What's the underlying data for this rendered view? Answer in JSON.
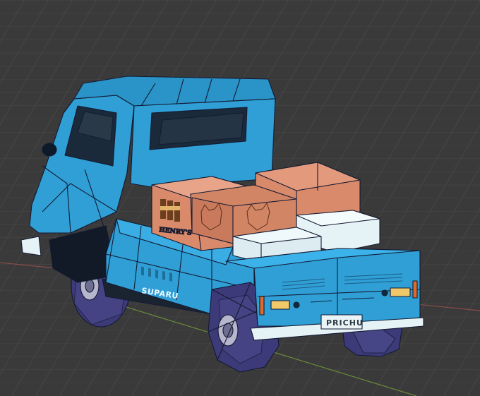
{
  "scene": {
    "background_color": "#3a3a3a",
    "grid_color": "#4a4a4a",
    "axis_red_color": "#8a4a4a",
    "axis_green_color": "#6a8a3a",
    "truck_body_color": "#2f9fd6",
    "wireframe_color": "#141a33",
    "box_cardboard_color": "#d98a6a",
    "box_white_color": "#e6f3f6"
  },
  "truck": {
    "brand_label": "SUPARU",
    "license_plate": "PRICHU",
    "box_brand": "HENRY'S"
  }
}
